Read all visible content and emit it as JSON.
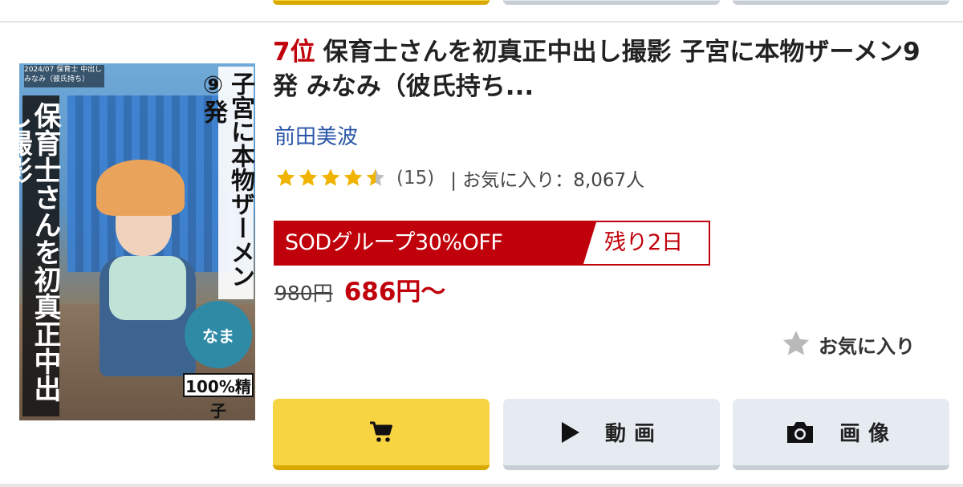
{
  "item": {
    "rank": "7位",
    "title": "保育士さんを初真正中出し撮影 子宮に本物ザーメン9発 みなみ（彼氏持ち...",
    "actress": "前田美波",
    "rating": {
      "value": 4.5,
      "max": 5,
      "reviews": "(15)",
      "favorites": "| お気に入り：8,067人"
    },
    "sale": {
      "label": "SODグループ30%OFF",
      "remaining": "残り2日"
    },
    "price": {
      "original": "980円",
      "current": "686円〜"
    },
    "favorite_button": "お気に入り",
    "buttons": {
      "cart_icon": "cart-icon",
      "video": "動画",
      "image": "画像"
    },
    "thumbnail": {
      "title_left": "保育士さんを初真正中出し撮影",
      "title_right": "子宮に本物ザーメン⑨発",
      "top_small": "2024/07 保育士 中出し みなみ（彼氏持ち）",
      "logo": "なま",
      "badge": "100%精子"
    }
  },
  "colors": {
    "rank_red": "#c0000a",
    "link_blue": "#2a56a8",
    "star_gold": "#f0b400",
    "cart_yellow": "#f7d442",
    "button_gray": "#e6ebf1"
  }
}
